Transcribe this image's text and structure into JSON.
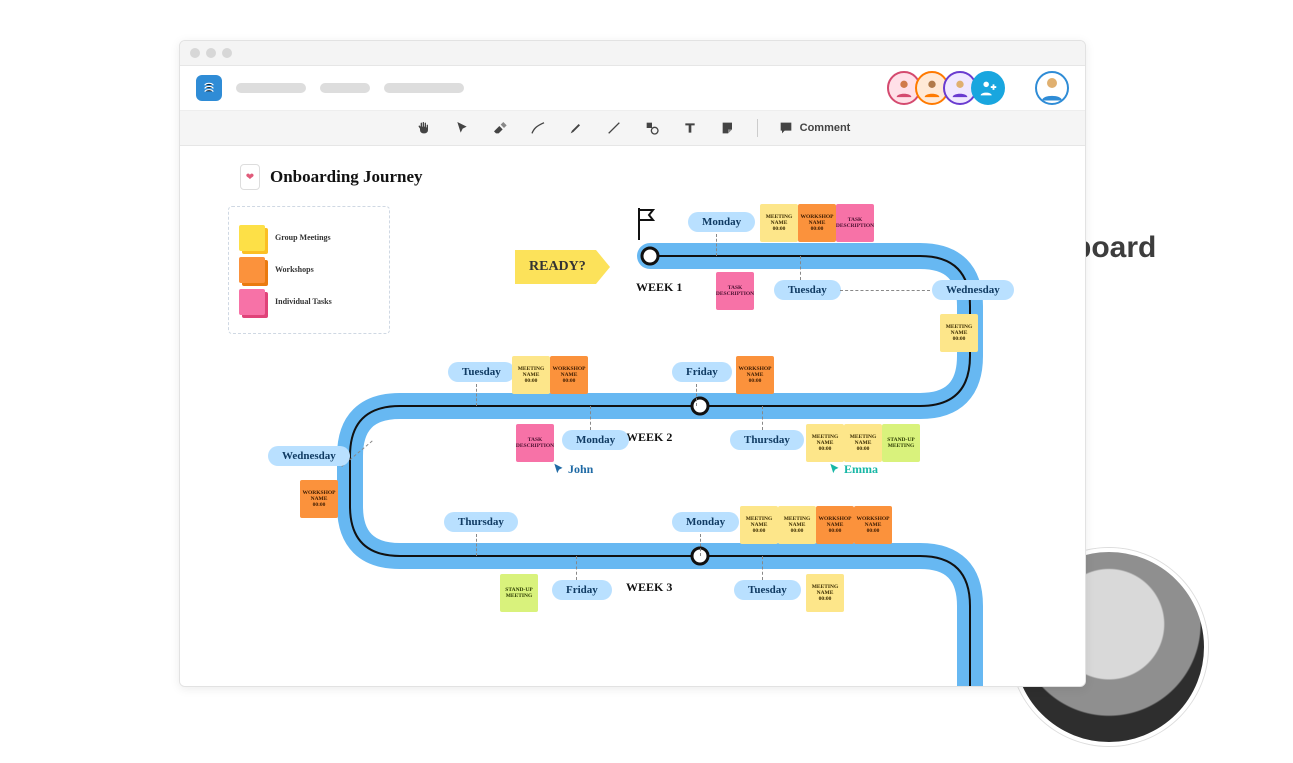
{
  "brand": {
    "name": "Conceptboard"
  },
  "toolbar": {
    "comment_label": "Comment"
  },
  "board": {
    "title": "Onboarding Journey",
    "ready_label": "READY?",
    "weeks": {
      "w1": "WEEK 1",
      "w2": "WEEK 2",
      "w3": "WEEK 3"
    }
  },
  "legend": {
    "yellow": "Group Meetings",
    "orange": "Workshops",
    "pink": "Individual Tasks"
  },
  "days": {
    "monday": "Monday",
    "tuesday": "Tuesday",
    "wednesday": "Wednesday",
    "thursday": "Thursday",
    "friday": "Friday"
  },
  "note_text": {
    "meeting_name": "MEETING NAME",
    "workshop_name": "WORKSHOP NAME",
    "task_desc": "TASK DESCRIPTION",
    "standup": "STAND-UP MEETING",
    "time": "00:00"
  },
  "cursors": {
    "john": "John",
    "emma": "Emma"
  },
  "avatars": {
    "a1_color": "#d44a6f",
    "a2_color": "#ff7a00",
    "a3_color": "#6a3bd0",
    "a4_color": "#19a6df",
    "me_color": "#2f8cd6"
  }
}
